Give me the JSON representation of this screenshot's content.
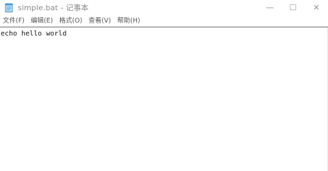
{
  "window": {
    "title": "simple.bat - 记事本",
    "icon": "notepad-document-icon",
    "controls": {
      "minimize": "—",
      "maximize": "☐",
      "close": "✕"
    }
  },
  "menubar": {
    "items": [
      {
        "label": "文件(F)"
      },
      {
        "label": "编辑(E)"
      },
      {
        "label": "格式(O)"
      },
      {
        "label": "查看(V)"
      },
      {
        "label": "帮助(H)"
      }
    ]
  },
  "editor": {
    "content": "echo hello world"
  }
}
